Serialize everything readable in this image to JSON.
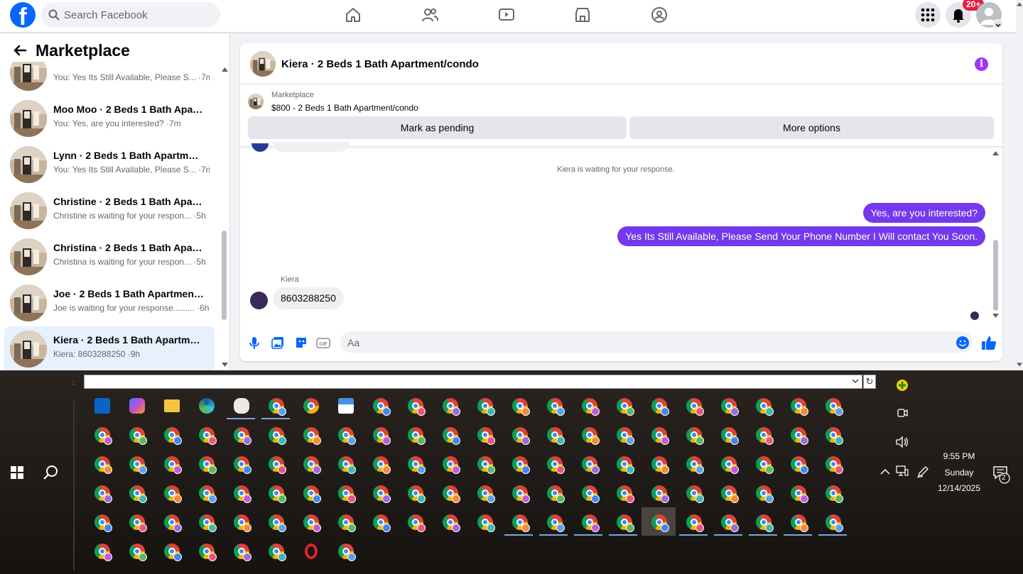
{
  "header": {
    "search_placeholder": "Search Facebook",
    "notification_badge": "20+",
    "nav_icons": [
      "home-icon",
      "friends-icon",
      "watch-icon",
      "marketplace-icon",
      "groups-icon"
    ],
    "right_icons": [
      "menu-grid-icon",
      "bell-icon",
      "profile-avatar"
    ]
  },
  "sidebar": {
    "title": "Marketplace",
    "conversations": [
      {
        "name": "",
        "preview": "You: Yes Its Still Available, Please S... ·7m"
      },
      {
        "name": "Moo Moo · 2 Beds 1 Bath Apart...",
        "preview": "You: Yes, are you interested? ·7m"
      },
      {
        "name": "Lynn · 2 Beds 1 Bath Apartment/...",
        "preview": "You: Yes Its Still Available, Please S... ·7m"
      },
      {
        "name": "Christine · 2 Beds 1 Bath Apartm...",
        "preview": "Christine is waiting for your respon... ·5h"
      },
      {
        "name": "Christina · 2 Beds 1 Bath Apartm...",
        "preview": "Christina is waiting for your respon... ·5h"
      },
      {
        "name": "Joe · 2 Beds 1 Bath Apartment/c...",
        "preview": "Joe is waiting for your response......... ·6h"
      },
      {
        "name": "Kiera · 2 Beds 1 Bath Apartment...",
        "preview": "Kiera: 8603288250 ·9h"
      }
    ]
  },
  "chat": {
    "title": "Kiera · 2 Beds 1 Bath Apartment/condo",
    "listing_label": "Marketplace",
    "listing_price": "$800 - 2 Beds 1 Bath Apartment/condo",
    "btn_pending": "Mark as pending",
    "btn_more": "More options",
    "waiting_text": "Kiera is waiting for your response.",
    "out_messages": [
      "Yes, are you interested?",
      "Yes Its Still Available, Please Send Your Phone Number I Will contact You Soon."
    ],
    "sender_name": "Kiera",
    "in_message": "8603288250",
    "composer_placeholder": "Aa",
    "composer_icons": [
      "microphone-icon",
      "photo-icon",
      "sticker-icon",
      "gif-icon"
    ]
  },
  "taskbar": {
    "url_value": "",
    "time": "9:55 PM",
    "day": "Sunday",
    "date": "12/14/2025",
    "notification_count": "2",
    "tray_icons": [
      "chevron-up-icon",
      "network-icon",
      "pen-icon",
      "volume-icon",
      "meet-now-icon",
      "app-tray-icon"
    ],
    "colors": {
      "chrome_red": "#db4437",
      "chrome_yellow": "#f4b400",
      "chrome_green": "#0f9d58",
      "chrome_blue": "#4285f4",
      "messenger_purple": "#7439ee",
      "fb_blue": "#0866ff"
    }
  }
}
